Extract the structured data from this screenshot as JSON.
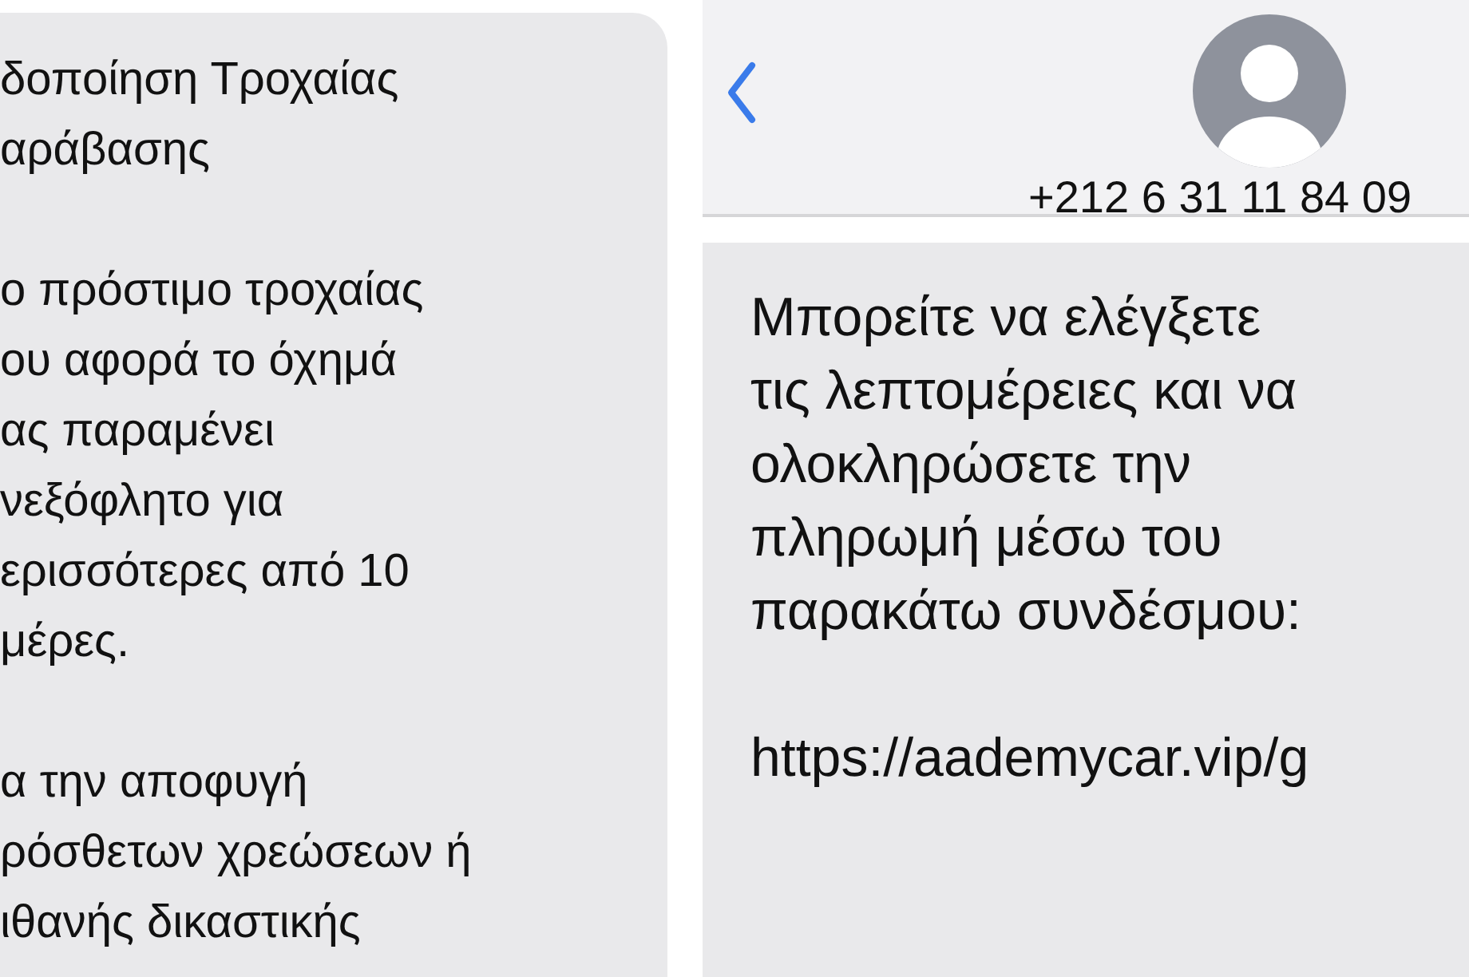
{
  "left_message": {
    "paragraphs": [
      "δοποίηση Τροχαίας\nαράβασης",
      "ο πρόστιμο τροχαίας\nου αφορά το όχημά\nας παραμένει\nνεξόφλητο για\nερισσότερες από 10\nμέρες.",
      "α την αποφυγή\nρόσθετων χρεώσεων ή\nιθανής δικαστικής"
    ]
  },
  "header": {
    "contact": "+212 6 31 11 84 09"
  },
  "right_message": {
    "paragraphs": [
      "Μπορείτε να ελέγξετε\nτις λεπτομέρειες και να\nολοκληρώσετε την\nπληρωμή μέσω του\nπαρακάτω συνδέσμου:"
    ],
    "link": "https://aademycar.vip/g"
  }
}
